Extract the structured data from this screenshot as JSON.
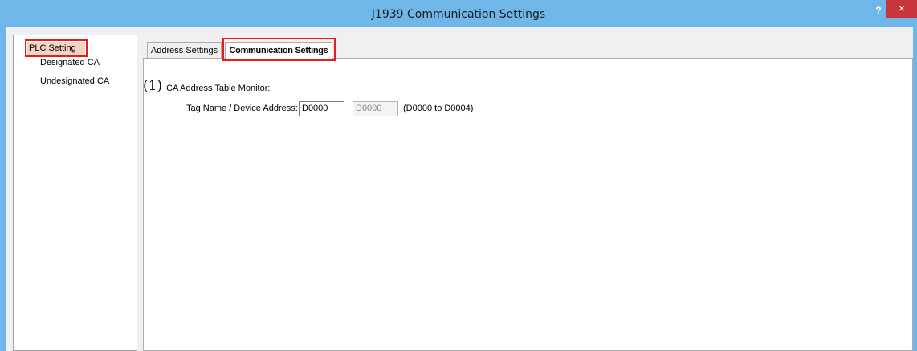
{
  "window": {
    "title": "J1939 Communication Settings",
    "help_label": "?",
    "close_label": "×"
  },
  "sidebar": {
    "items": [
      {
        "label": "PLC Setting",
        "selected": true
      },
      {
        "label": "Designated CA",
        "selected": false
      },
      {
        "label": "Undesignated CA",
        "selected": false
      }
    ]
  },
  "tabs": [
    {
      "label": "Address Settings",
      "active": false
    },
    {
      "label": "Communication Settings",
      "active": true
    }
  ],
  "content": {
    "section_number": "(1)",
    "section_title": "CA Address Table Monitor:",
    "field_label": "Tag Name / Device Address:",
    "address_value": "D0000",
    "address_end_value": "D0000",
    "range_text": "(D0000 to D0004)"
  },
  "colors": {
    "titlebar": "#6fb7e8",
    "highlight_box": "#e02020",
    "close_button": "#c7353d"
  }
}
